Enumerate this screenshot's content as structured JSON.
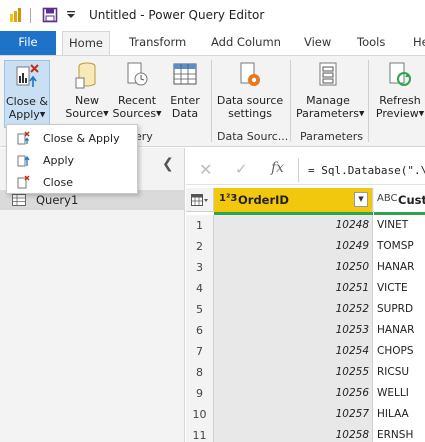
{
  "window": {
    "title": "Untitled - Power Query Editor"
  },
  "tabs": [
    {
      "label": "File"
    },
    {
      "label": "Home"
    },
    {
      "label": "Transform"
    },
    {
      "label": "Add Column"
    },
    {
      "label": "View"
    },
    {
      "label": "Tools"
    },
    {
      "label": "He"
    }
  ],
  "ribbon": {
    "close_apply": {
      "line1": "Close &",
      "line2": "Apply"
    },
    "new_source": {
      "line1": "New",
      "line2": "Source"
    },
    "recent_sources": {
      "line1": "Recent",
      "line2": "Sources"
    },
    "enter_data": {
      "line1": "Enter",
      "line2": "Data"
    },
    "data_source_settings": {
      "line1": "Data source",
      "line2": "settings"
    },
    "manage_parameters": {
      "line1": "Manage",
      "line2": "Parameters"
    },
    "refresh_preview": {
      "line1": "Refresh",
      "line2": "Preview"
    },
    "group_query_partial": "uery",
    "group_data_sources": "Data Sourc...",
    "group_parameters": "Parameters"
  },
  "dropdown_menu": {
    "items": [
      {
        "label": "Close & Apply"
      },
      {
        "label": "Apply"
      },
      {
        "label": "Close"
      }
    ]
  },
  "queries": {
    "items": [
      {
        "label": "Query1"
      }
    ]
  },
  "formula_bar": {
    "cancel_glyph": "✕",
    "commit_glyph": "✓",
    "fx_label": "fx",
    "equals": "=",
    "formula": "Sql.Database(\".\\"
  },
  "grid": {
    "columns": [
      {
        "name": "OrderID",
        "type_icon": "1²3"
      },
      {
        "name": "Custo",
        "type_icon": "ABC"
      }
    ],
    "rows": [
      {
        "n": "1",
        "order_id": "10248",
        "customer": "VINET"
      },
      {
        "n": "2",
        "order_id": "10249",
        "customer": "TOMSP"
      },
      {
        "n": "3",
        "order_id": "10250",
        "customer": "HANAR"
      },
      {
        "n": "4",
        "order_id": "10251",
        "customer": "VICTE"
      },
      {
        "n": "5",
        "order_id": "10252",
        "customer": "SUPRD"
      },
      {
        "n": "6",
        "order_id": "10253",
        "customer": "HANAR"
      },
      {
        "n": "7",
        "order_id": "10254",
        "customer": "CHOPS"
      },
      {
        "n": "8",
        "order_id": "10255",
        "customer": "RICSU"
      },
      {
        "n": "9",
        "order_id": "10256",
        "customer": "WELLI"
      },
      {
        "n": "10",
        "order_id": "10257",
        "customer": "HILAA"
      },
      {
        "n": "11",
        "order_id": "10258",
        "customer": "ERNSH"
      }
    ]
  },
  "colors": {
    "file_tab": "#1e73c8",
    "selected_column": "#f2c80f",
    "quality_bar": "#2ea44f",
    "ribbon_bg": "#f3f3f3"
  }
}
